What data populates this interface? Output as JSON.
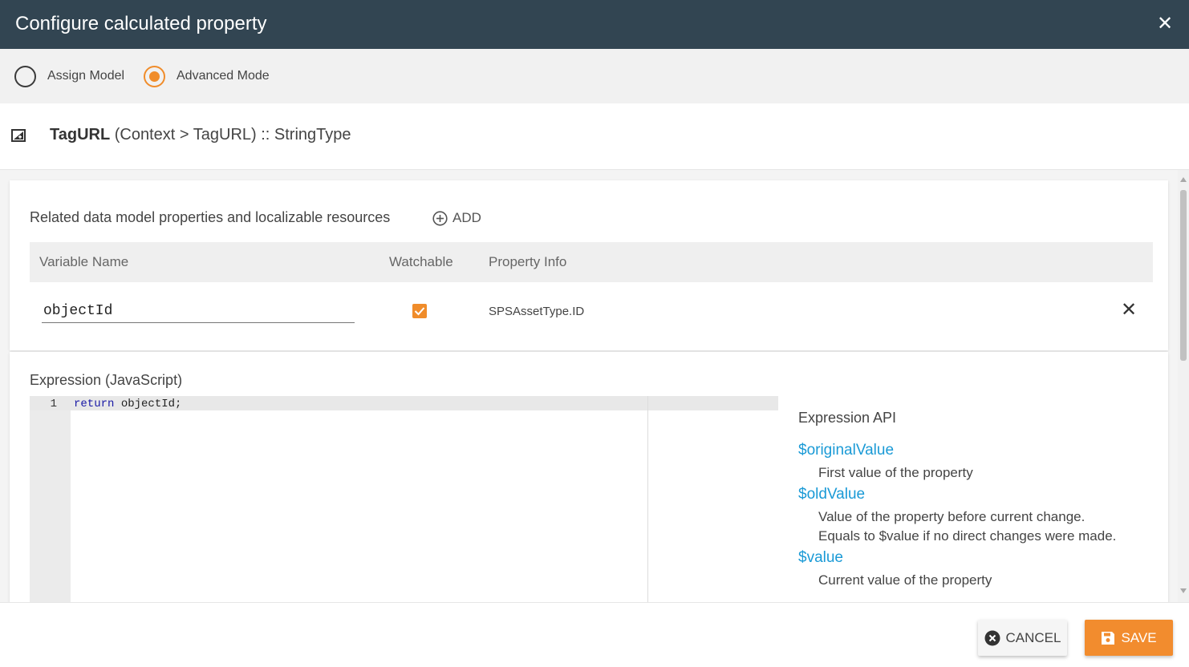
{
  "dialog": {
    "title": "Configure calculated property",
    "close_icon": "close-icon"
  },
  "mode": {
    "options": [
      {
        "label": "Assign Model",
        "selected": false
      },
      {
        "label": "Advanced Mode",
        "selected": true
      }
    ],
    "accent_color": "#f08c2a"
  },
  "property": {
    "icon": "edit-square-icon",
    "name": "TagURL",
    "path": "(Context > TagURL) :: StringType"
  },
  "related": {
    "title": "Related data model properties and localizable resources",
    "add_label": "ADD",
    "columns": [
      "Variable Name",
      "Watchable",
      "Property Info"
    ],
    "rows": [
      {
        "variable": "objectId",
        "watchable": true,
        "info": "SPSAssetType.ID"
      }
    ]
  },
  "expression": {
    "title": "Expression (JavaScript)",
    "line_number": "1",
    "code_keyword": "return",
    "code_rest": " objectId;"
  },
  "api": {
    "title": "Expression API",
    "items": [
      {
        "name": "$originalValue",
        "desc": [
          "First value of the property"
        ]
      },
      {
        "name": "$oldValue",
        "desc": [
          "Value of the property before current change.",
          "Equals to $value if no direct changes were made."
        ]
      },
      {
        "name": "$value",
        "desc": [
          "Current value of the property"
        ]
      }
    ],
    "link_color": "#1a9ad6"
  },
  "footer": {
    "cancel_label": "CANCEL",
    "save_label": "SAVE",
    "save_color": "#f28c2e"
  }
}
